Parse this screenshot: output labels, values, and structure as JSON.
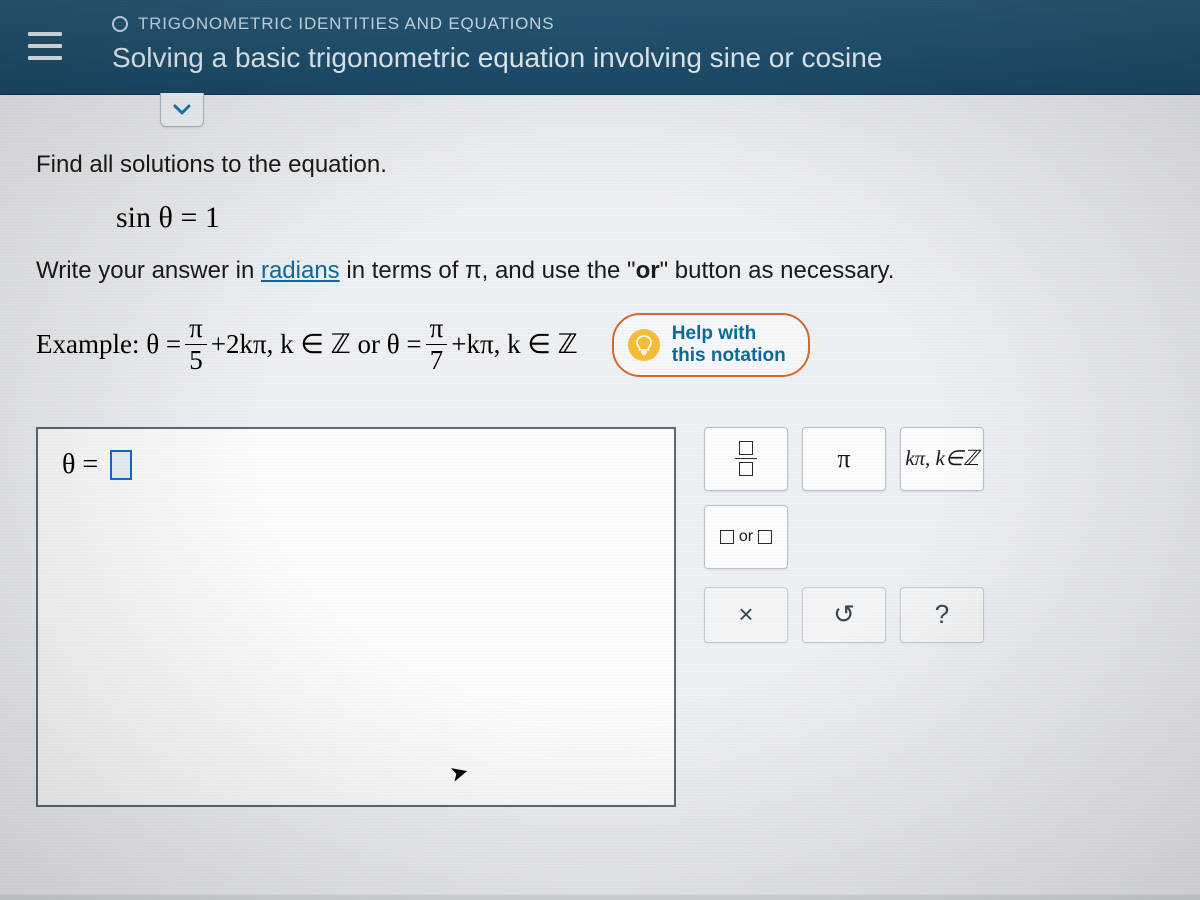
{
  "header": {
    "category": "TRIGONOMETRIC IDENTITIES AND EQUATIONS",
    "title": "Solving a basic trigonometric equation involving sine or cosine"
  },
  "problem": {
    "instruction": "Find all solutions to the equation.",
    "equation_lhs": "sin θ",
    "equation_rhs": "1",
    "instruction2_pre": "Write your answer in ",
    "radians_word": "radians",
    "instruction2_mid": " in terms of π, and use the \"",
    "or_word": "or",
    "instruction2_post": "\" button as necessary."
  },
  "example": {
    "label": "Example: θ = ",
    "frac1_num": "π",
    "frac1_den": "5",
    "part1": " +2kπ, k ∈ ℤ or θ = ",
    "frac2_num": "π",
    "frac2_den": "7",
    "part2": " +kπ, k ∈ ℤ"
  },
  "help": {
    "line1": "Help with",
    "line2": "this notation"
  },
  "answer": {
    "theta_prefix": "θ ="
  },
  "tools": {
    "pi": "π",
    "kz": "kπ, k∈ℤ",
    "or": "or"
  },
  "controls": {
    "clear": "×",
    "undo": "↺",
    "help": "?"
  }
}
